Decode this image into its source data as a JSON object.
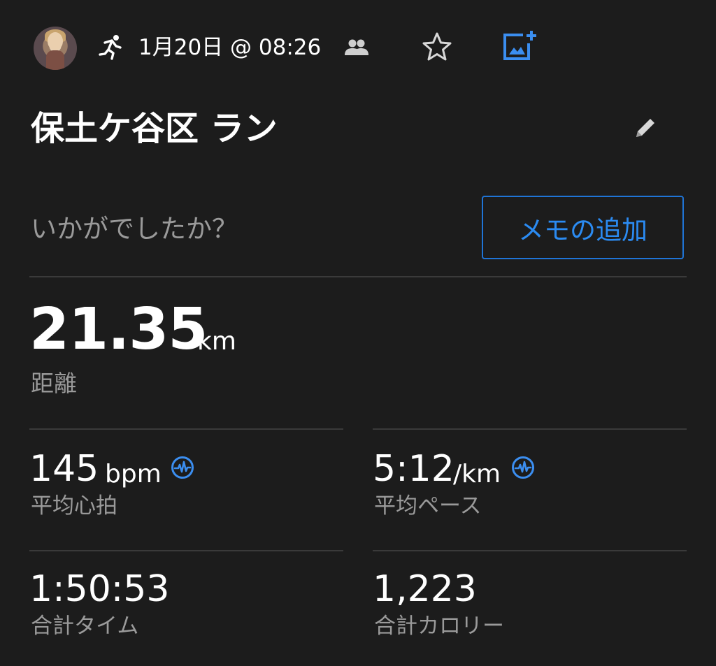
{
  "header": {
    "avatar_icon": "user-avatar",
    "activity_icon": "running-icon",
    "date_time": "1月20日 @ 08:26",
    "people_icon": "people-icon",
    "star_icon": "star-outline-icon",
    "add_photo_icon": "add-photo-icon",
    "accent_color": "#3b8ef0"
  },
  "activity": {
    "title": "保土ケ谷区 ラン",
    "edit_icon": "pencil-icon"
  },
  "memo": {
    "prompt": "いかがでしたか？",
    "button_label": "メモの追加",
    "button_color": "#1f74d6"
  },
  "distance": {
    "value": "21.35",
    "unit": "km",
    "label": "距離"
  },
  "stats": {
    "heart_rate": {
      "value": "145",
      "unit": "bpm",
      "label": "平均心拍",
      "icon": "heart-rate-wave-icon"
    },
    "pace": {
      "value": "5:12",
      "unit": "/km",
      "label": "平均ペース",
      "icon": "heart-rate-wave-icon"
    },
    "total_time": {
      "value": "1:50:53",
      "label": "合計タイム"
    },
    "total_calories": {
      "value": "1,223",
      "label": "合計カロリー"
    }
  }
}
